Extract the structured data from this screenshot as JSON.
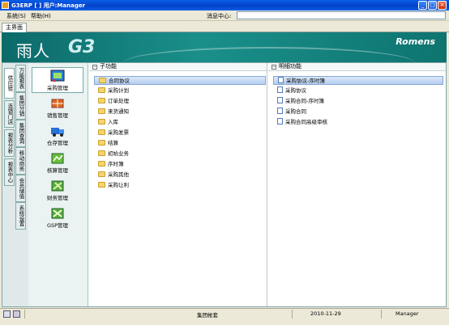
{
  "window": {
    "title": "G3ERP [ ] 用户:Manager"
  },
  "titlebar_buttons": {
    "minimize": "_",
    "maximize": "□",
    "close": "×"
  },
  "menu": {
    "items": [
      "系统(S)",
      "帮助(H)"
    ],
    "message_label": "消息中心:"
  },
  "tabs": [
    "主界面"
  ],
  "banner": {
    "brand": "雨人",
    "product": "G3",
    "vendor": "Romens"
  },
  "side_tabs": [
    "供应链",
    "万能报表",
    "集团分销",
    "连锁门店",
    "集团查询",
    "报表分析",
    "移动商务",
    "报表中心",
    "会员储值",
    "系统设置"
  ],
  "modules": [
    {
      "label": "采购管理",
      "icon": "purchase-icon",
      "active": true
    },
    {
      "label": "销售管理",
      "icon": "sales-icon",
      "active": false
    },
    {
      "label": "仓存管理",
      "icon": "warehouse-icon",
      "active": false
    },
    {
      "label": "核算管理",
      "icon": "accounting-icon",
      "active": false
    },
    {
      "label": "财务管理",
      "icon": "finance-icon",
      "active": false
    },
    {
      "label": "GSP管理",
      "icon": "gsp-icon",
      "active": false
    }
  ],
  "sub_functions": {
    "header": "子功能",
    "items": [
      "合同协议",
      "采购计划",
      "订单处理",
      "来货通知",
      "入库",
      "采购发票",
      "结算",
      "初始业务",
      "序时簿",
      "采购其他",
      "采购让利"
    ],
    "selected": 0
  },
  "detail_functions": {
    "header": "明细功能",
    "items": [
      "采购协议-序时簿",
      "采购协议",
      "采购合同-序时簿",
      "采购合同",
      "采购合同高级审核"
    ],
    "selected": 0
  },
  "statusbar": {
    "company": "集团帐套",
    "date": "2010-11-29",
    "user": "Manager"
  },
  "colors": {
    "banner": "#0e7470",
    "titlebar": "#0a5ee8",
    "selection": "#b6cef0"
  }
}
